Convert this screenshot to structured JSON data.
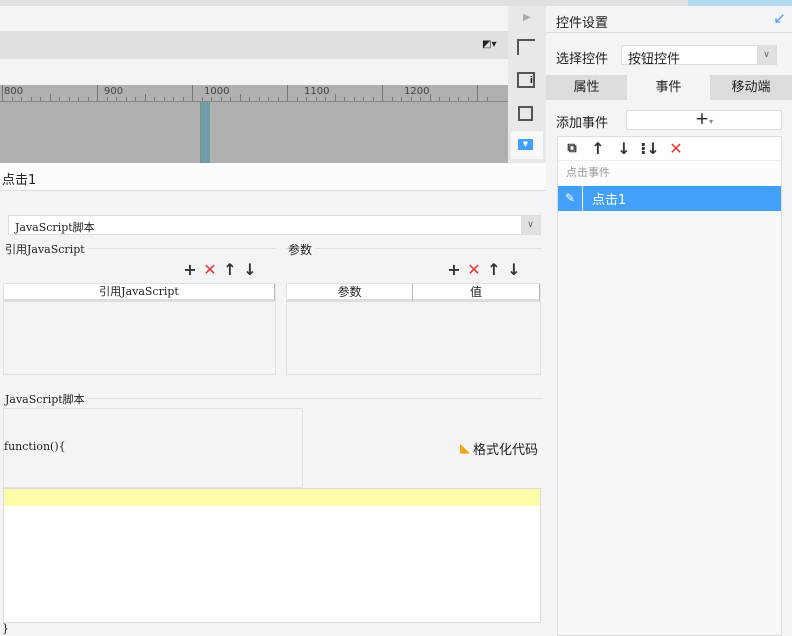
{
  "ruler": {
    "labels": [
      "800",
      "900",
      "1000",
      "1100",
      "1200"
    ]
  },
  "event_name": "点击1",
  "script_type": {
    "value": "JavaScript脚本"
  },
  "ref_js": {
    "legend": "引用JavaScript",
    "column": "引用JavaScript"
  },
  "params": {
    "legend": "参数",
    "columns": [
      "参数",
      "值"
    ]
  },
  "script": {
    "legend": "JavaScript脚本",
    "header": "function(){",
    "footer": "}",
    "format_label": "格式化代码"
  },
  "panel": {
    "title": "控件设置",
    "select_label": "选择控件",
    "select_value": "按钮控件",
    "tabs": [
      "属性",
      "事件",
      "移动端"
    ],
    "active_tab": "事件",
    "add_event_label": "添加事件",
    "event_group": "点击事件",
    "events": [
      "点击1"
    ]
  },
  "colors": {
    "accent": "#42a0f8",
    "canvas": "#b0b0b0",
    "marker": "#6e9fa8",
    "highlight_line": "#fffcaa"
  }
}
